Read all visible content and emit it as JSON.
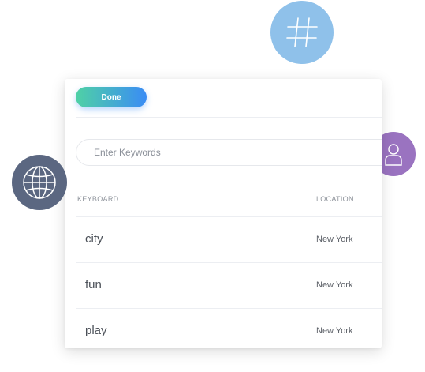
{
  "done_label": "Done",
  "search": {
    "placeholder": "Enter Keywords",
    "value": ""
  },
  "table": {
    "headers": {
      "keyword": "KEYBOARD",
      "location": "LOCATION"
    },
    "rows": [
      {
        "keyword": "city",
        "location": "New York"
      },
      {
        "keyword": "fun",
        "location": "New York"
      },
      {
        "keyword": "play",
        "location": "New York"
      }
    ]
  },
  "floating_icons": [
    {
      "name": "hashtag-icon",
      "color": "#8fc1ea"
    },
    {
      "name": "user-icon",
      "color": "#9a73c0"
    },
    {
      "name": "globe-icon",
      "color": "#5b6781"
    }
  ],
  "colors": {
    "button_gradient_start": "#4fd1a5",
    "button_gradient_end": "#3a8cf5"
  }
}
